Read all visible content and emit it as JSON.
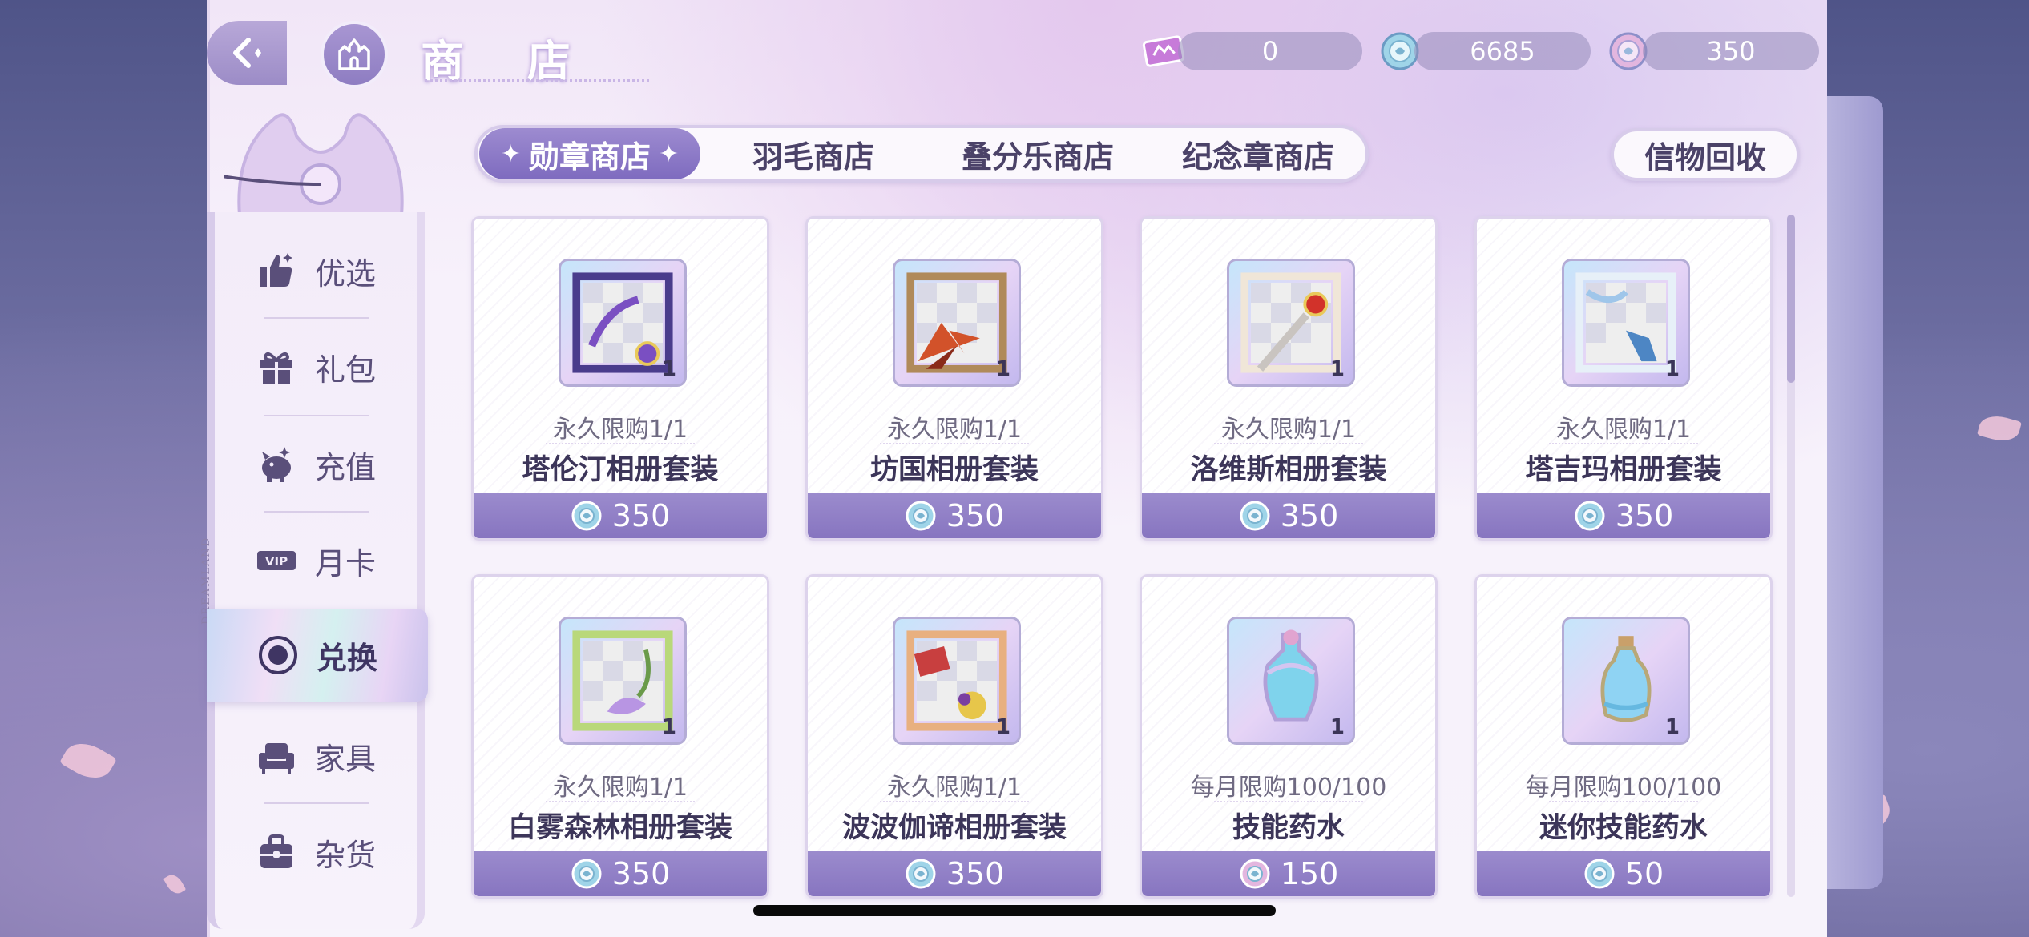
{
  "header": {
    "title": "商 店",
    "currencies": [
      {
        "name": "ticket",
        "value": "0"
      },
      {
        "name": "blue-gem",
        "value": "6685"
      },
      {
        "name": "pink-gem",
        "value": "350"
      }
    ]
  },
  "sidebar": {
    "items": [
      {
        "label": "优选",
        "icon": "thumbs-up-icon"
      },
      {
        "label": "礼包",
        "icon": "gift-icon"
      },
      {
        "label": "充值",
        "icon": "piggy-bank-icon"
      },
      {
        "label": "月卡",
        "icon": "vip-icon"
      },
      {
        "label": "兑换",
        "icon": "exchange-icon",
        "active": true
      },
      {
        "label": "家具",
        "icon": "sofa-icon"
      },
      {
        "label": "杂货",
        "icon": "bag-icon"
      }
    ],
    "brand_text": "DREAMLAND"
  },
  "tabs": [
    {
      "label": "勋章商店",
      "active": true
    },
    {
      "label": "羽毛商店"
    },
    {
      "label": "叠分乐商店"
    },
    {
      "label": "纪念章商店"
    }
  ],
  "recycle_button": "信物回收",
  "items": [
    {
      "limit": "永久限购1/1",
      "name": "塔伦汀相册套装",
      "price": "350",
      "qty": "1",
      "currency": "blue"
    },
    {
      "limit": "永久限购1/1",
      "name": "坊国相册套装",
      "price": "350",
      "qty": "1",
      "currency": "blue"
    },
    {
      "limit": "永久限购1/1",
      "name": "洛维斯相册套装",
      "price": "350",
      "qty": "1",
      "currency": "blue"
    },
    {
      "limit": "永久限购1/1",
      "name": "塔吉玛相册套装",
      "price": "350",
      "qty": "1",
      "currency": "blue"
    },
    {
      "limit": "永久限购1/1",
      "name": "白雾森林相册套装",
      "price": "350",
      "qty": "1",
      "currency": "blue"
    },
    {
      "limit": "永久限购1/1",
      "name": "波波伽谛相册套装",
      "price": "350",
      "qty": "1",
      "currency": "blue"
    },
    {
      "limit": "每月限购100/100",
      "name": "技能药水",
      "price": "150",
      "qty": "1",
      "currency": "pink"
    },
    {
      "limit": "每月限购100/100",
      "name": "迷你技能药水",
      "price": "50",
      "qty": "1",
      "currency": "blue"
    }
  ],
  "colors": {
    "accent": "#8775c0",
    "panel": "#f7f3fb",
    "text": "#3c3559"
  }
}
